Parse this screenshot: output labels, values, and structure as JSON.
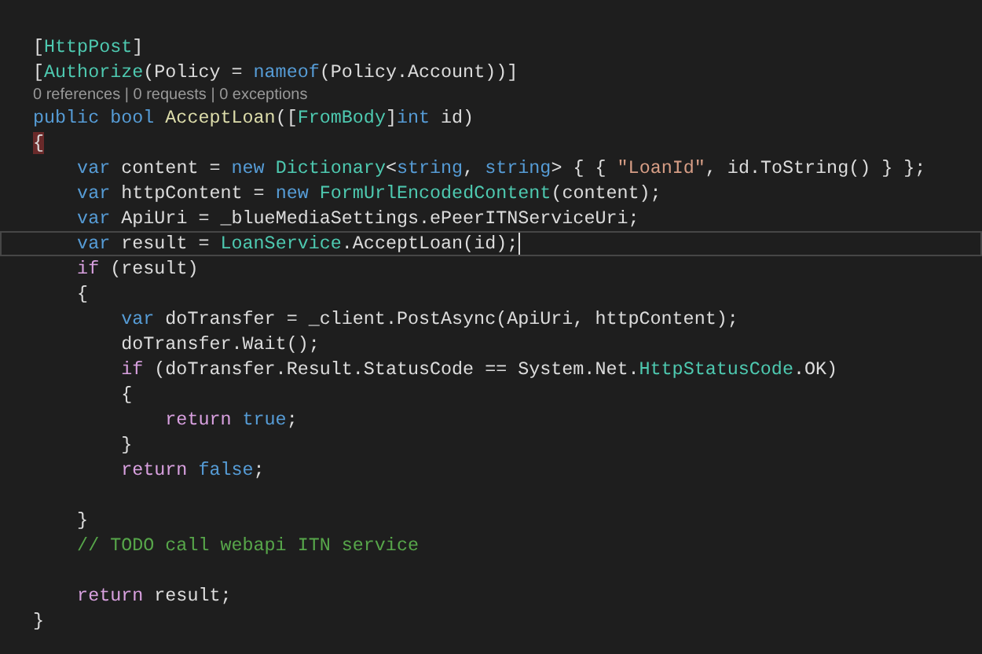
{
  "editor": {
    "lines": [
      {
        "kind": "code",
        "current": false,
        "tokens": [
          {
            "text": "[",
            "kind": "plain"
          },
          {
            "text": "HttpPost",
            "kind": "type"
          },
          {
            "text": "]",
            "kind": "plain"
          }
        ]
      },
      {
        "kind": "code",
        "current": false,
        "tokens": [
          {
            "text": "[",
            "kind": "plain"
          },
          {
            "text": "Authorize",
            "kind": "type"
          },
          {
            "text": "(Policy = ",
            "kind": "plain"
          },
          {
            "text": "nameof",
            "kind": "keyword"
          },
          {
            "text": "(Policy.Account))]",
            "kind": "plain"
          }
        ]
      },
      {
        "kind": "lens",
        "current": false,
        "tokens": [
          {
            "text": "0 references | 0 requests | 0 exceptions",
            "kind": "lens"
          }
        ]
      },
      {
        "kind": "code",
        "current": false,
        "tokens": [
          {
            "text": "public bool ",
            "kind": "keyword"
          },
          {
            "text": "AcceptLoan",
            "kind": "method"
          },
          {
            "text": "([",
            "kind": "plain"
          },
          {
            "text": "FromBody",
            "kind": "type"
          },
          {
            "text": "]",
            "kind": "plain"
          },
          {
            "text": "int",
            "kind": "keyword"
          },
          {
            "text": " id)",
            "kind": "plain"
          }
        ]
      },
      {
        "kind": "code",
        "current": false,
        "tokens": [
          {
            "text": "{",
            "kind": "brace_match"
          }
        ]
      },
      {
        "kind": "code",
        "current": false,
        "tokens": [
          {
            "text": "    var",
            "kind": "keyword"
          },
          {
            "text": " content = ",
            "kind": "plain"
          },
          {
            "text": "new ",
            "kind": "keyword"
          },
          {
            "text": "Dictionary",
            "kind": "type"
          },
          {
            "text": "<",
            "kind": "plain"
          },
          {
            "text": "string",
            "kind": "keyword"
          },
          {
            "text": ", ",
            "kind": "plain"
          },
          {
            "text": "string",
            "kind": "keyword"
          },
          {
            "text": "> { { ",
            "kind": "plain"
          },
          {
            "text": "\"LoanId\"",
            "kind": "string"
          },
          {
            "text": ", id.ToString() } };",
            "kind": "plain"
          }
        ]
      },
      {
        "kind": "code",
        "current": false,
        "tokens": [
          {
            "text": "    var",
            "kind": "keyword"
          },
          {
            "text": " httpContent = ",
            "kind": "plain"
          },
          {
            "text": "new ",
            "kind": "keyword"
          },
          {
            "text": "FormUrlEncodedContent",
            "kind": "type"
          },
          {
            "text": "(content);",
            "kind": "plain"
          }
        ]
      },
      {
        "kind": "code",
        "current": false,
        "tokens": [
          {
            "text": "    var",
            "kind": "keyword"
          },
          {
            "text": " ApiUri = _blueMediaSettings.ePeerITNServiceUri;",
            "kind": "plain"
          }
        ]
      },
      {
        "kind": "code",
        "current": true,
        "tokens": [
          {
            "text": "    var",
            "kind": "keyword"
          },
          {
            "text": " result = ",
            "kind": "plain"
          },
          {
            "text": "LoanService",
            "kind": "type"
          },
          {
            "text": ".AcceptLoan(id);",
            "kind": "plain"
          }
        ]
      },
      {
        "kind": "code",
        "current": false,
        "tokens": [
          {
            "text": "    if",
            "kind": "control"
          },
          {
            "text": " (result)",
            "kind": "plain"
          }
        ]
      },
      {
        "kind": "code",
        "current": false,
        "tokens": [
          {
            "text": "    {",
            "kind": "plain"
          }
        ]
      },
      {
        "kind": "code",
        "current": false,
        "tokens": [
          {
            "text": "        var",
            "kind": "keyword"
          },
          {
            "text": " doTransfer = _client.PostAsync(ApiUri, httpContent);",
            "kind": "plain"
          }
        ]
      },
      {
        "kind": "code",
        "current": false,
        "tokens": [
          {
            "text": "        doTransfer.Wait();",
            "kind": "plain"
          }
        ]
      },
      {
        "kind": "code",
        "current": false,
        "tokens": [
          {
            "text": "        if",
            "kind": "control"
          },
          {
            "text": " (doTransfer.Result.StatusCode == System.Net.",
            "kind": "plain"
          },
          {
            "text": "HttpStatusCode",
            "kind": "type"
          },
          {
            "text": ".OK)",
            "kind": "plain"
          }
        ]
      },
      {
        "kind": "code",
        "current": false,
        "tokens": [
          {
            "text": "        {",
            "kind": "plain"
          }
        ]
      },
      {
        "kind": "code",
        "current": false,
        "tokens": [
          {
            "text": "            return ",
            "kind": "control"
          },
          {
            "text": "true",
            "kind": "keyword"
          },
          {
            "text": ";",
            "kind": "plain"
          }
        ]
      },
      {
        "kind": "code",
        "current": false,
        "tokens": [
          {
            "text": "        }",
            "kind": "plain"
          }
        ]
      },
      {
        "kind": "code",
        "current": false,
        "tokens": [
          {
            "text": "        return ",
            "kind": "control"
          },
          {
            "text": "false",
            "kind": "keyword"
          },
          {
            "text": ";",
            "kind": "plain"
          }
        ]
      },
      {
        "kind": "blank",
        "current": false
      },
      {
        "kind": "code",
        "current": false,
        "tokens": [
          {
            "text": "    }",
            "kind": "plain"
          }
        ]
      },
      {
        "kind": "code",
        "current": false,
        "tokens": [
          {
            "text": "    // TODO call webapi ITN service",
            "kind": "comment"
          }
        ]
      },
      {
        "kind": "blank",
        "current": false
      },
      {
        "kind": "code",
        "current": false,
        "tokens": [
          {
            "text": "    return",
            "kind": "control"
          },
          {
            "text": " result;",
            "kind": "plain"
          }
        ]
      },
      {
        "kind": "code",
        "current": false,
        "tokens": [
          {
            "text": "}",
            "kind": "plain"
          }
        ]
      }
    ]
  }
}
